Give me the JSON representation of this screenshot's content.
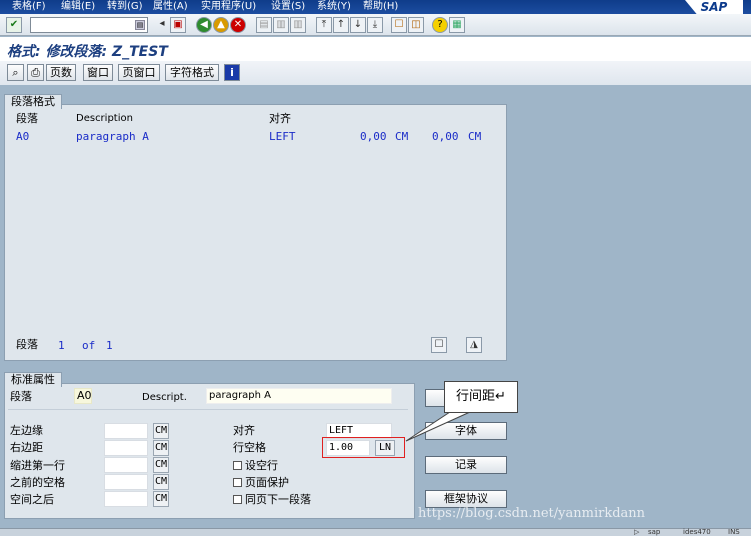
{
  "menu": [
    "表格(F)",
    "编辑(E)",
    "转到(G)",
    "属性(A)",
    "实用程序(U)",
    "设置(S)",
    "系统(Y)",
    "帮助(H)"
  ],
  "brand": "SAP",
  "page_title": "格式: 修改段落: Z_TEST",
  "app_toolbar": {
    "page_count": "页数",
    "window": "窗口",
    "page_window": "页窗口",
    "char_format": "字符格式",
    "info": "i"
  },
  "paragraph_panel": {
    "tab": "段落格式",
    "headers": {
      "paragraph": "段落",
      "description": "Description",
      "align": "对齐"
    },
    "rows": [
      {
        "code": "A0",
        "desc": "paragraph A",
        "align": "LEFT",
        "v1": "0,00",
        "u1": "CM",
        "v2": "0,00",
        "u2": "CM"
      }
    ],
    "footer": {
      "label": "段落",
      "current": "1",
      "of": "of",
      "total": "1"
    }
  },
  "std_panel": {
    "tab": "标准属性",
    "paragraph_label": "段落",
    "paragraph_value": "A0",
    "descript_label": "Descript.",
    "descript_value": "paragraph A",
    "left_margin": "左边缘",
    "right_margin": "右边距",
    "first_indent": "缩进第一行",
    "space_before": "之前的空格",
    "space_after": "空间之后",
    "unit": "CM",
    "align_label": "对齐",
    "align_value": "LEFT",
    "line_spacing_label": "行空格",
    "line_spacing_value": "1.00",
    "line_spacing_unit": "LN",
    "no_blank": "设空行",
    "page_protect": "页面保护",
    "same_page_next": "同页下一段落"
  },
  "right_buttons": {
    "font": "字体",
    "tabs": "记录",
    "outline": "框架协议"
  },
  "callout": "行间距↵",
  "watermark": "https://blog.csdn.net/yanmirkdann",
  "status": {
    "a": "▷",
    "b": "sap",
    "c": "ides470",
    "d": "INS"
  }
}
